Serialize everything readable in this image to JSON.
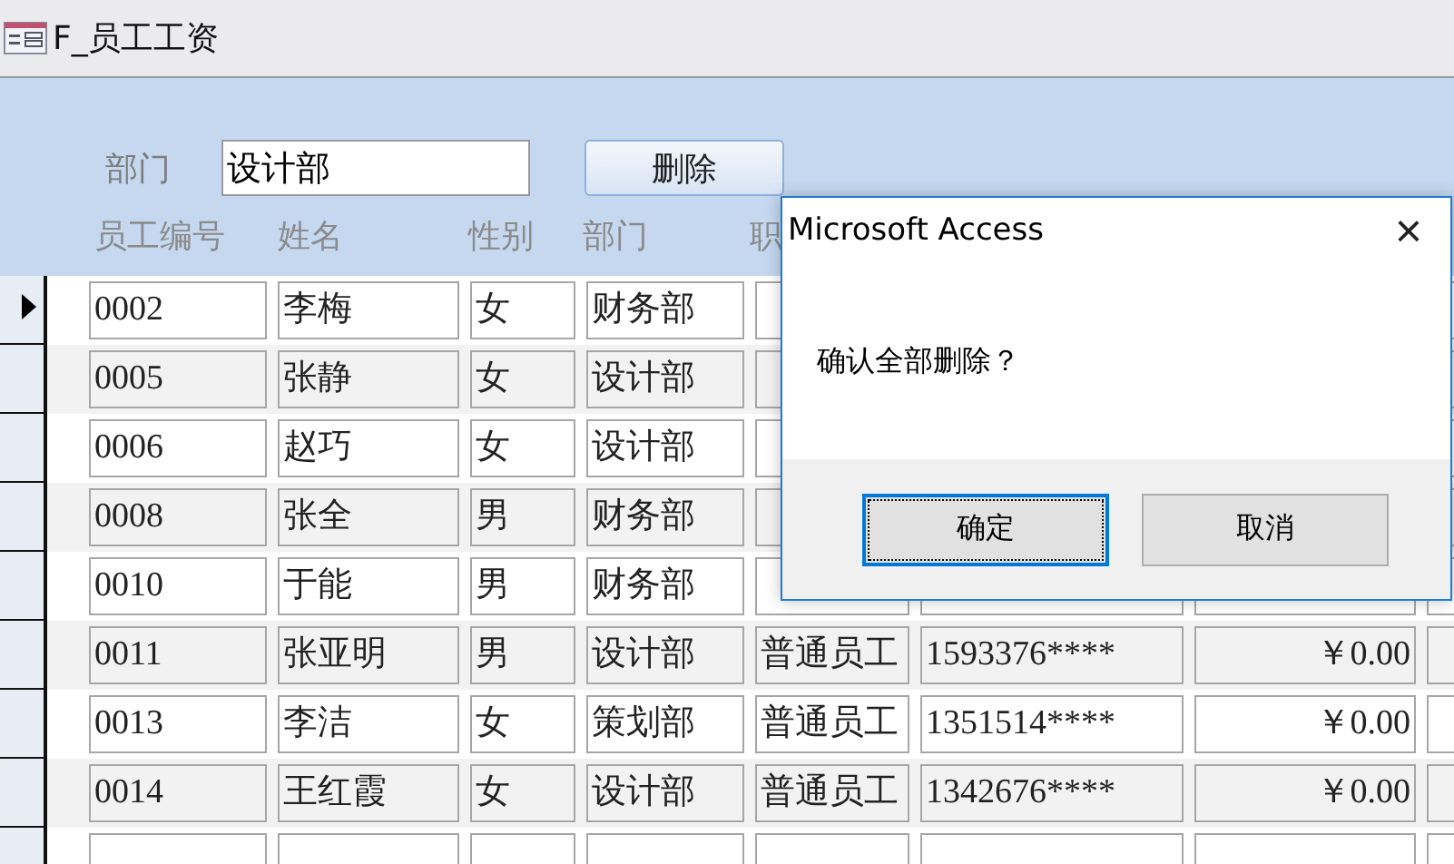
{
  "window": {
    "title": "F_员工工资"
  },
  "filter": {
    "label": "部门",
    "value": "设计部",
    "button": "删除"
  },
  "table": {
    "columns": [
      "员工编号",
      "姓名",
      "性别",
      "部门",
      "职"
    ],
    "rows": [
      {
        "selected": true,
        "cells": [
          "0002",
          "李梅",
          "女",
          "财务部"
        ]
      },
      {
        "selected": false,
        "cells": [
          "0005",
          "张静",
          "女",
          "设计部"
        ]
      },
      {
        "selected": false,
        "cells": [
          "0006",
          "赵巧",
          "女",
          "设计部"
        ]
      },
      {
        "selected": false,
        "cells": [
          "0008",
          "张全",
          "男",
          "财务部"
        ]
      },
      {
        "selected": false,
        "cells": [
          "0010",
          "于能",
          "男",
          "财务部"
        ]
      },
      {
        "selected": false,
        "cells": [
          "0011",
          "张亚明",
          "男",
          "设计部",
          "普通员工",
          "1593376****",
          "￥0.00"
        ]
      },
      {
        "selected": false,
        "cells": [
          "0013",
          "李洁",
          "女",
          "策划部",
          "普通员工",
          "1351514****",
          "￥0.00"
        ]
      },
      {
        "selected": false,
        "cells": [
          "0014",
          "王红霞",
          "女",
          "设计部",
          "普通员工",
          "1342676****",
          "￥0.00"
        ]
      },
      {
        "selected": false
      }
    ]
  },
  "dialog": {
    "title": "Microsoft Access",
    "close": "×",
    "message": "确认全部删除？",
    "buttons": [
      {
        "label": "确定",
        "focused": true
      },
      {
        "label": "取消",
        "focused": false
      }
    ]
  }
}
